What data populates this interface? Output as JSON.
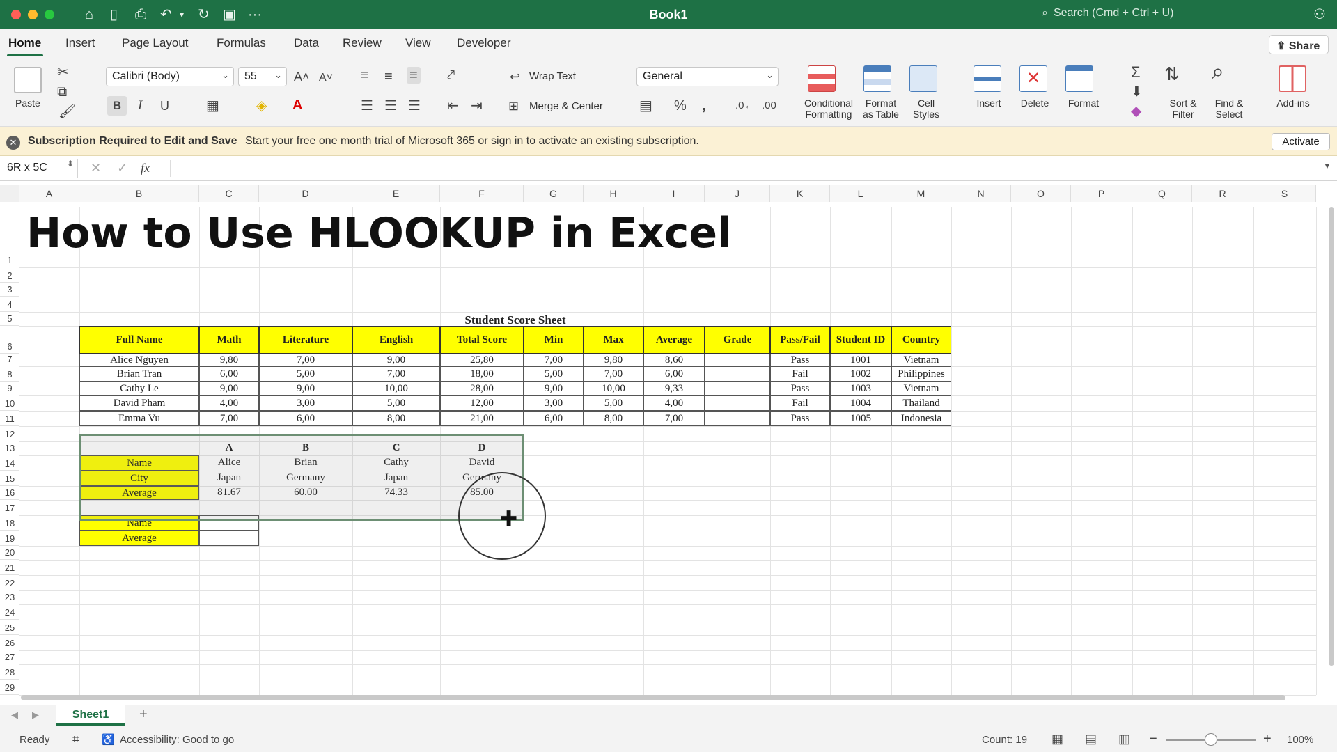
{
  "titlebar": {
    "title": "Book1",
    "search_placeholder": "Search (Cmd + Ctrl + U)",
    "more": "···"
  },
  "tabs": [
    "Home",
    "Insert",
    "Page Layout",
    "Formulas",
    "Data",
    "Review",
    "View",
    "Developer"
  ],
  "share_label": "Share",
  "ribbon": {
    "paste": "Paste",
    "font_name": "Calibri (Body)",
    "font_size": "55",
    "bold": "B",
    "italic": "I",
    "underline": "U",
    "wrap_text": "Wrap Text",
    "merge_center": "Merge & Center",
    "number_format": "General",
    "conditional_formatting": [
      "Conditional",
      "Formatting"
    ],
    "format_as_table": [
      "Format",
      "as Table"
    ],
    "cell_styles": [
      "Cell",
      "Styles"
    ],
    "insert": "Insert",
    "delete": "Delete",
    "format": "Format",
    "sort_filter": [
      "Sort &",
      "Filter"
    ],
    "find_select": [
      "Find &",
      "Select"
    ],
    "addins": "Add-ins"
  },
  "notice": {
    "bold": "Subscription Required to Edit and Save",
    "text": "Start your free one month trial of Microsoft 365 or sign in to activate an existing subscription.",
    "button": "Activate"
  },
  "formula_bar": {
    "name_box": "6R x 5C",
    "fx": "fx",
    "value": ""
  },
  "columns": [
    "A",
    "B",
    "C",
    "D",
    "E",
    "F",
    "G",
    "H",
    "I",
    "J",
    "K",
    "L",
    "M",
    "N",
    "O",
    "P",
    "Q",
    "R",
    "S"
  ],
  "rows": [
    "1",
    "2",
    "3",
    "4",
    "5",
    "6",
    "7",
    "8",
    "9",
    "10",
    "11",
    "12",
    "13",
    "14",
    "15",
    "16",
    "17",
    "18",
    "19",
    "20",
    "21",
    "22",
    "23",
    "24",
    "25",
    "26",
    "27",
    "28",
    "29"
  ],
  "sheet": {
    "title": "How to Use HLOOKUP in Excel",
    "table_title": "Student Score Sheet",
    "headers": [
      "Full Name",
      "Math",
      "Literature",
      "English",
      "Total Score",
      "Min",
      "Max",
      "Average",
      "Grade",
      "Pass/Fail",
      "Student ID",
      "Country"
    ],
    "rows": [
      [
        "Alice Nguyen",
        "9,80",
        "7,00",
        "9,00",
        "25,80",
        "7,00",
        "9,80",
        "8,60",
        "",
        "Pass",
        "1001",
        "Vietnam"
      ],
      [
        "Brian Tran",
        "6,00",
        "5,00",
        "7,00",
        "18,00",
        "5,00",
        "7,00",
        "6,00",
        "",
        "Fail",
        "1002",
        "Philippines"
      ],
      [
        "Cathy Le",
        "9,00",
        "9,00",
        "10,00",
        "28,00",
        "9,00",
        "10,00",
        "9,33",
        "",
        "Pass",
        "1003",
        "Vietnam"
      ],
      [
        "David Pham",
        "4,00",
        "3,00",
        "5,00",
        "12,00",
        "3,00",
        "5,00",
        "4,00",
        "",
        "Fail",
        "1004",
        "Thailand"
      ],
      [
        "Emma Vu",
        "7,00",
        "6,00",
        "8,00",
        "21,00",
        "6,00",
        "8,00",
        "7,00",
        "",
        "Pass",
        "1005",
        "Indonesia"
      ]
    ],
    "lookup": {
      "col_headers": [
        "A",
        "B",
        "C",
        "D"
      ],
      "rows": [
        [
          "Name",
          "Alice",
          "Brian",
          "Cathy",
          "David"
        ],
        [
          "City",
          "Japan",
          "Germany",
          "Japan",
          "Germany"
        ],
        [
          "Average",
          "81.67",
          "60.00",
          "74.33",
          "85.00"
        ]
      ]
    },
    "query": [
      [
        "Name",
        ""
      ],
      [
        "Average",
        ""
      ]
    ]
  },
  "sheet_tabs": {
    "active": "Sheet1",
    "add": "+"
  },
  "status": {
    "ready": "Ready",
    "accessibility": "Accessibility: Good to go",
    "count": "Count: 19",
    "zoom": "100%"
  }
}
